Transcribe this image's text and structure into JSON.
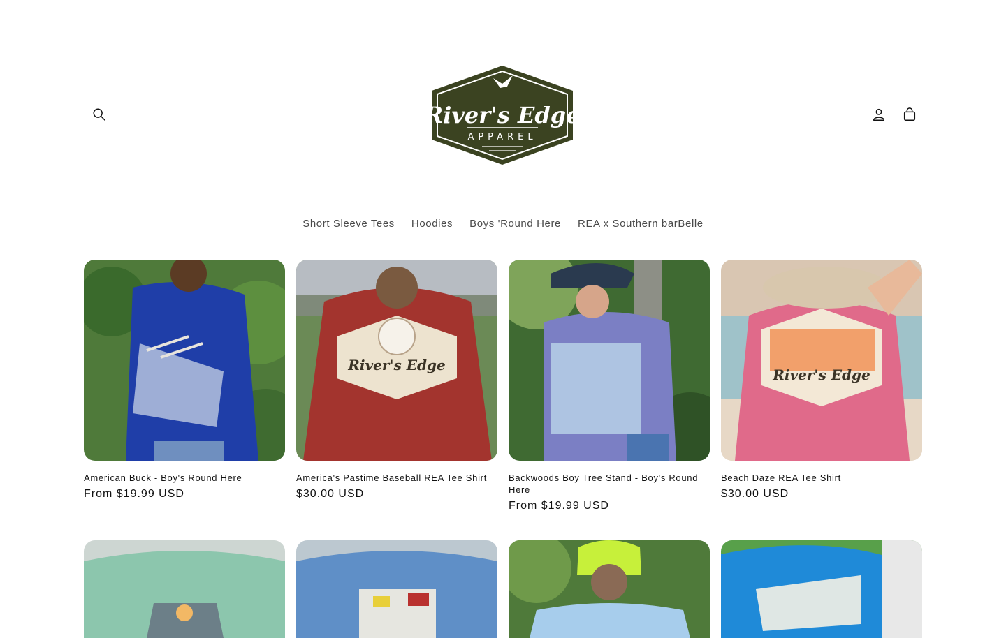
{
  "header": {
    "logo_alt": "River's Edge Apparel",
    "logo_text_main": "River's Edge",
    "logo_text_sub": "APPAREL",
    "search_icon": "search-icon",
    "account_icon": "account-icon",
    "cart_icon": "cart-icon"
  },
  "nav": {
    "items": [
      {
        "label": "Short Sleeve Tees"
      },
      {
        "label": "Hoodies"
      },
      {
        "label": "Boys 'Round Here"
      },
      {
        "label": "REA x Southern barBelle"
      }
    ]
  },
  "products": [
    {
      "title": "American Buck - Boy's Round Here",
      "price": "From $19.99 USD"
    },
    {
      "title": "America's Pastime Baseball REA Tee Shirt",
      "price": "$30.00 USD"
    },
    {
      "title": "Backwoods Boy Tree Stand - Boy's Round Here",
      "price": "From $19.99 USD"
    },
    {
      "title": "Beach Daze REA Tee Shirt",
      "price": "$30.00 USD"
    }
  ],
  "colors": {
    "brand_green": "#3b4321",
    "nav_text": "#4a4a4a"
  }
}
